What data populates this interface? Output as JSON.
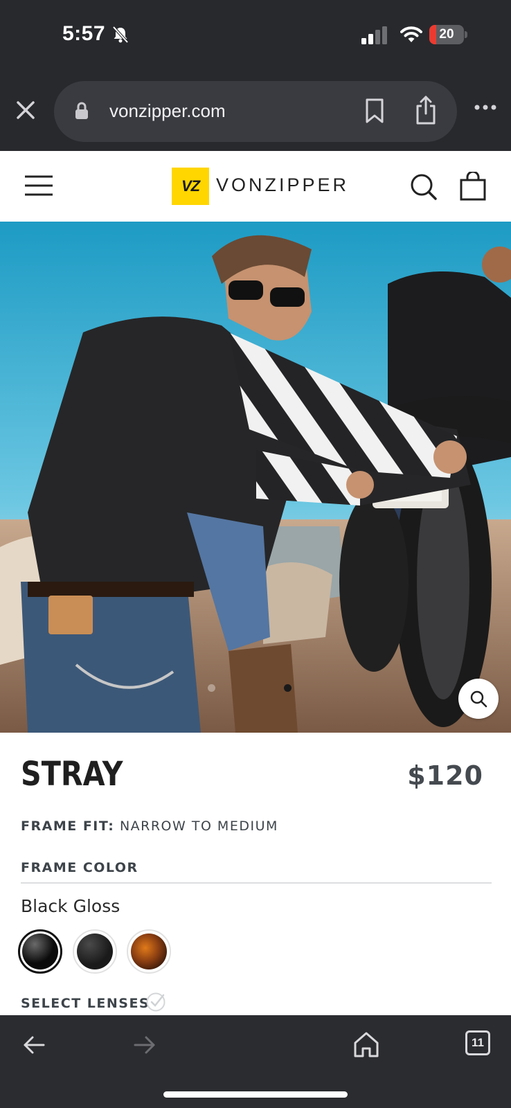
{
  "status_bar": {
    "time": "5:57",
    "battery": "20",
    "battery_level": 0.2
  },
  "browser": {
    "url": "vonzipper.com",
    "tab_count": "11"
  },
  "site": {
    "logo_mark": "VZ",
    "logo_word": "VONZIPPER"
  },
  "product": {
    "name": "STRAY",
    "price": "$120",
    "frame_fit_label": "FRAME FIT:",
    "frame_fit_value": "NARROW TO MEDIUM",
    "frame_color_label": "FRAME COLOR",
    "selected_color": "Black Gloss",
    "select_lenses_label": "SELECT LENSES",
    "carousel": {
      "slides": 2,
      "active": 2
    }
  },
  "colors": {
    "status_bg": "#28292d",
    "brand_yellow": "#ffd600",
    "swatches": [
      "#0b0b0b",
      "#1a1a1a",
      "#8a3e12"
    ]
  }
}
